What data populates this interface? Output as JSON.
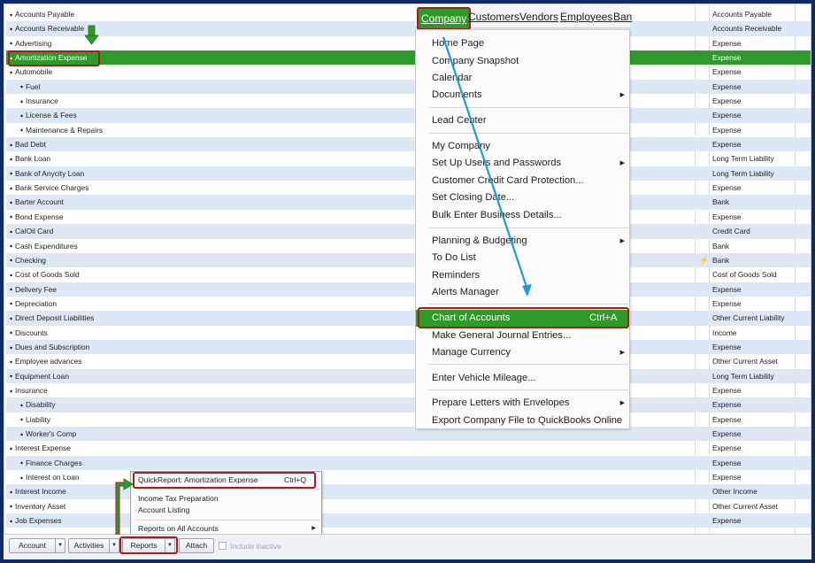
{
  "accounts": [
    {
      "name": "Accounts Payable",
      "type": "Accounts Payable",
      "sub": false
    },
    {
      "name": "Accounts Receivable",
      "type": "Accounts Receivable",
      "sub": false
    },
    {
      "name": "Advertising",
      "type": "Expense",
      "sub": false
    },
    {
      "name": "Amortization Expense",
      "type": "Expense",
      "sub": false,
      "selected": true
    },
    {
      "name": "Automobile",
      "type": "Expense",
      "sub": false
    },
    {
      "name": "Fuel",
      "type": "Expense",
      "sub": true
    },
    {
      "name": "Insurance",
      "type": "Expense",
      "sub": true
    },
    {
      "name": "License & Fees",
      "type": "Expense",
      "sub": true
    },
    {
      "name": "Maintenance & Repairs",
      "type": "Expense",
      "sub": true
    },
    {
      "name": "Bad Debt",
      "type": "Expense",
      "sub": false
    },
    {
      "name": "Bank Loan",
      "type": "Long Term Liability",
      "sub": false
    },
    {
      "name": "Bank of Anycity Loan",
      "type": "Long Term Liability",
      "sub": false
    },
    {
      "name": "Bank Service Charges",
      "type": "Expense",
      "sub": false
    },
    {
      "name": "Barter Account",
      "type": "Bank",
      "sub": false
    },
    {
      "name": "Bond Expense",
      "type": "Expense",
      "sub": false
    },
    {
      "name": "CalOil Card",
      "type": "Credit Card",
      "sub": false
    },
    {
      "name": "Cash Expenditures",
      "type": "Bank",
      "sub": false
    },
    {
      "name": "Checking",
      "type": "Bank",
      "sub": false,
      "online": true
    },
    {
      "name": "Cost of Goods Sold",
      "type": "Cost of Goods Sold",
      "sub": false
    },
    {
      "name": "Delivery Fee",
      "type": "Expense",
      "sub": false
    },
    {
      "name": "Depreciation",
      "type": "Expense",
      "sub": false
    },
    {
      "name": "Direct Deposit Liabilities",
      "type": "Other Current Liability",
      "sub": false
    },
    {
      "name": "Discounts",
      "type": "Income",
      "sub": false
    },
    {
      "name": "Dues and Subscription",
      "type": "Expense",
      "sub": false
    },
    {
      "name": "Employee advances",
      "type": "Other Current Asset",
      "sub": false
    },
    {
      "name": "Equipment Loan",
      "type": "Long Term Liability",
      "sub": false
    },
    {
      "name": "Insurance",
      "type": "Expense",
      "sub": false
    },
    {
      "name": "Disability",
      "type": "Expense",
      "sub": true
    },
    {
      "name": "Liability",
      "type": "Expense",
      "sub": true
    },
    {
      "name": "Worker's Comp",
      "type": "Expense",
      "sub": true
    },
    {
      "name": "Interest Expense",
      "type": "Expense",
      "sub": false
    },
    {
      "name": "Finance Charges",
      "type": "Expense",
      "sub": true
    },
    {
      "name": "Interest on Loan",
      "type": "Expense",
      "sub": true
    },
    {
      "name": "Interest Income",
      "type": "Other Income",
      "sub": false
    },
    {
      "name": "Inventory Asset",
      "type": "Other Current Asset",
      "sub": false
    },
    {
      "name": "Job Expenses",
      "type": "Expense",
      "sub": false
    }
  ],
  "menubar": {
    "company": "Company",
    "customers": "Customers",
    "vendors": "Vendors",
    "employees": "Employees",
    "banking": "Ban"
  },
  "company_menu": [
    "Home Page",
    "Company Snapshot",
    "Calendar",
    "Documents",
    "Lead Center",
    "My Company",
    "Set Up Users and Passwords",
    "Customer Credit Card Protection...",
    "Set Closing Date...",
    "Bulk Enter Business Details...",
    "Planning & Budgeting",
    "To Do List",
    "Reminders",
    "Alerts Manager",
    "Chart of Accounts",
    "Make General Journal Entries...",
    "Manage Currency",
    "Enter Vehicle Mileage...",
    "Prepare Letters with Envelopes",
    "Export Company File to QuickBooks Online"
  ],
  "chart_of_accounts_shortcut": "Ctrl+A",
  "reports_menu": {
    "quickreport": "QuickReport: Amortization Expense",
    "quickreport_shortcut": "Ctrl+Q",
    "income_tax": "Income Tax Preparation",
    "account_listing": "Account Listing",
    "all_accounts": "Reports on All Accounts"
  },
  "toolbar": {
    "account": "Account",
    "activities": "Activities",
    "reports": "Reports",
    "attach": "Attach",
    "include_inactive": "Include inactive"
  },
  "icons": {
    "bullet": "diamond-bullet-icon",
    "submenu": "triangle-right-icon",
    "dropdown": "triangle-down-icon",
    "online": "lightning-bolt-icon",
    "annotation_arrow": "green-down-arrow-icon"
  },
  "colors": {
    "selection": "#2e9a2a",
    "alt_row": "#dde8f6",
    "highlight_box": "#a81c1c",
    "annotation_line": "#1a9be0",
    "frame": "#0d2a6b"
  }
}
